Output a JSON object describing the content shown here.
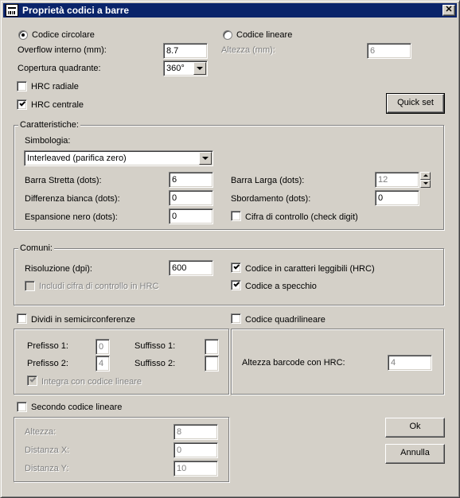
{
  "window": {
    "title": "Proprietà codici a barre",
    "close": "✕"
  },
  "top": {
    "codice_circolare": "Codice circolare",
    "codice_lineare": "Codice lineare",
    "overflow_label": "Overflow interno (mm):",
    "overflow_value": "8.7",
    "altezza_label": "Altezza (mm):",
    "altezza_value": "6",
    "copertura_label": "Copertura quadrante:",
    "copertura_value": "360°",
    "hrc_radiale": "HRC radiale",
    "hrc_centrale": "HRC centrale",
    "quick_set": "Quick set"
  },
  "caratteristiche": {
    "title": "Caratteristiche:",
    "simbologia_label": "Simbologia:",
    "simbologia_value": "Interleaved (parifica zero)",
    "barra_stretta_label": "Barra Stretta (dots):",
    "barra_stretta_value": "6",
    "barra_larga_label": "Barra Larga (dots):",
    "barra_larga_value": "12",
    "differenza_label": "Differenza bianca (dots):",
    "differenza_value": "0",
    "sbordamento_label": "Sbordamento (dots):",
    "sbordamento_value": "0",
    "espansione_label": "Espansione nero (dots):",
    "espansione_value": "0",
    "cifra_controllo_label": "Cifra di controllo (check digit)"
  },
  "comuni": {
    "title": "Comuni:",
    "risoluzione_label": "Risoluzione (dpi):",
    "risoluzione_value": "600",
    "includi_cifra": "Includi cifra di controllo in HRC",
    "codice_hrc": "Codice in caratteri leggibili (HRC)",
    "codice_specchio": "Codice a specchio"
  },
  "semicirconferenze": {
    "dividi_label": "Dividi in semicirconferenze",
    "prefisso1_label": "Prefisso 1:",
    "prefisso1_value": "0",
    "suffisso1_label": "Suffisso 1:",
    "suffisso1_value": "",
    "prefisso2_label": "Prefisso 2:",
    "prefisso2_value": "4",
    "suffisso2_label": "Suffisso 2:",
    "suffisso2_value": "",
    "integra_label": "Integra con codice lineare"
  },
  "quadrilineare": {
    "codice_label": "Codice quadrilineare",
    "altezza_hrc_label": "Altezza barcode con HRC:",
    "altezza_hrc_value": "4"
  },
  "secondo": {
    "label": "Secondo codice lineare",
    "altezza_label": "Altezza:",
    "altezza_value": "8",
    "distanza_x_label": "Distanza X:",
    "distanza_x_value": "0",
    "distanza_y_label": "Distanza Y:",
    "distanza_y_value": "10"
  },
  "buttons": {
    "ok": "Ok",
    "annulla": "Annulla"
  }
}
